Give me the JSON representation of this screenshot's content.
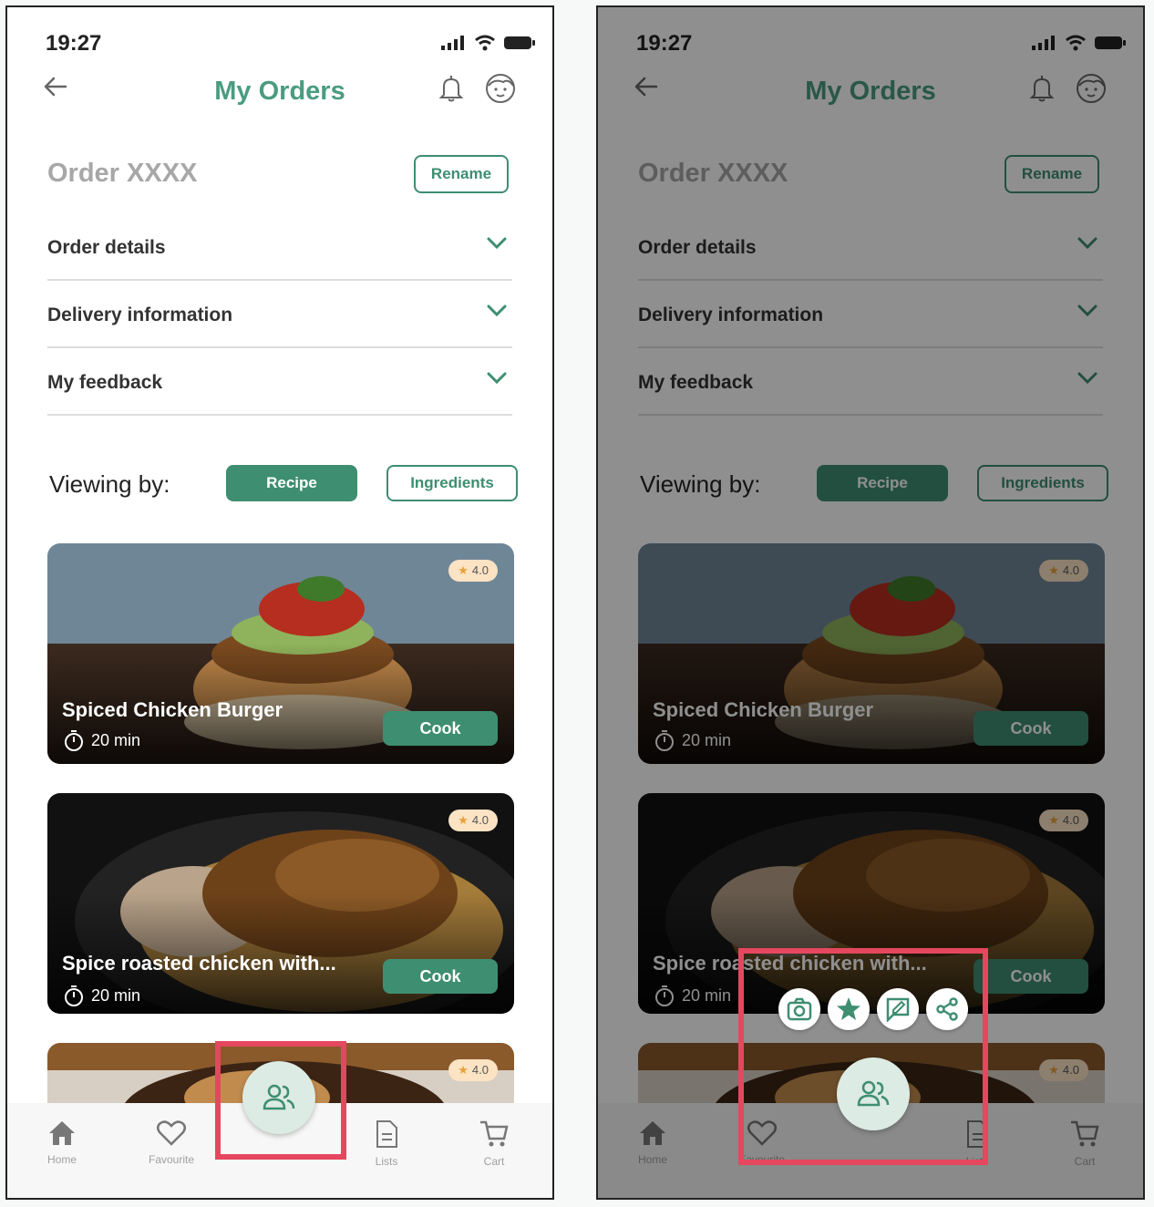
{
  "status": {
    "time": "19:27"
  },
  "header": {
    "title": "My Orders"
  },
  "order": {
    "name": "Order XXXX",
    "rename_label": "Rename"
  },
  "accordion": [
    {
      "label": "Order details"
    },
    {
      "label": "Delivery information"
    },
    {
      "label": "My feedback"
    }
  ],
  "viewing": {
    "label": "Viewing by:",
    "recipe": "Recipe",
    "ingredients": "Ingredients",
    "selected": "Recipe"
  },
  "cards": [
    {
      "title": "Spiced Chicken Burger",
      "time": "20 min",
      "rating": "4.0",
      "cook_label": "Cook"
    },
    {
      "title": "Spice roasted chicken with...",
      "time": "20 min",
      "rating": "4.0",
      "cook_label": "Cook"
    },
    {
      "rating": "4.0"
    }
  ],
  "nav": [
    {
      "label": "Home",
      "icon": "home-icon"
    },
    {
      "label": "Favourite",
      "icon": "heart-icon"
    },
    {
      "label": "Lists",
      "icon": "list-icon"
    },
    {
      "label": "Cart",
      "icon": "cart-icon"
    }
  ],
  "fab": {
    "icon": "users-icon"
  },
  "quick_actions": [
    {
      "icon": "camera-icon"
    },
    {
      "icon": "star-icon"
    },
    {
      "icon": "feedback-icon"
    },
    {
      "icon": "share-icon"
    }
  ],
  "colors": {
    "accent": "#3e8e71",
    "title": "#4a9c80",
    "highlight": "#e5475f",
    "rating_bg": "#fbe3c4"
  }
}
